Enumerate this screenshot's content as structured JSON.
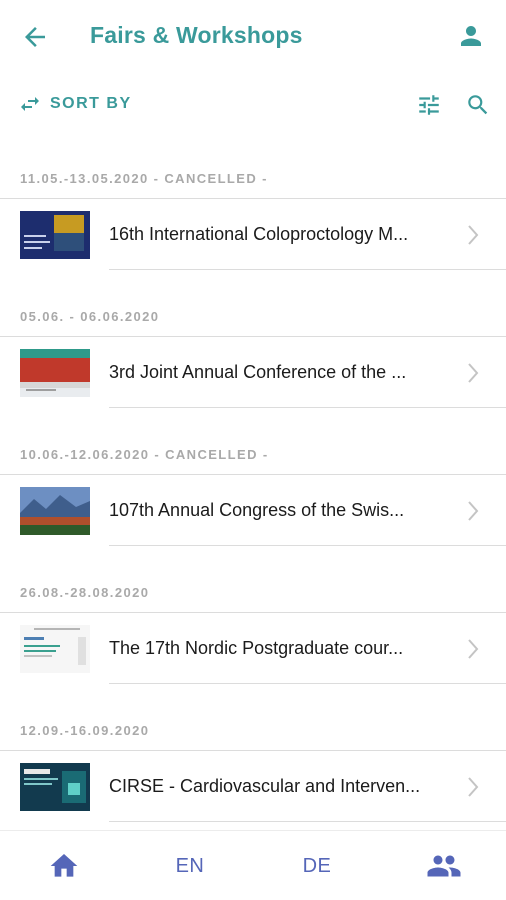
{
  "header": {
    "title": "Fairs & Workshops",
    "back_icon": "arrow-left-icon",
    "profile_icon": "person-icon"
  },
  "toolbar": {
    "sort_label": "SORT BY",
    "sort_icon": "swap-arrows-icon",
    "filter_icon": "tune-sliders-icon",
    "search_icon": "search-icon"
  },
  "colors": {
    "accent": "#3a9a9a",
    "nav": "#5566b8",
    "section_text": "#a9a9a9",
    "divider": "#dcdcdc"
  },
  "events": [
    {
      "date": "11.05.-13.05.2020 - CANCELLED -",
      "title": "16th International Coloproctology M..."
    },
    {
      "date": "05.06. - 06.06.2020",
      "title": "3rd Joint Annual Conference of the ..."
    },
    {
      "date": "10.06.-12.06.2020 - CANCELLED -",
      "title": "107th Annual Congress of the Swis..."
    },
    {
      "date": "26.08.-28.08.2020",
      "title": "The 17th Nordic Postgraduate cour..."
    },
    {
      "date": "12.09.-16.09.2020",
      "title": "CIRSE - Cardiovascular and Interven..."
    }
  ],
  "bottom_nav": {
    "home_icon": "home-icon",
    "lang_en": "EN",
    "lang_de": "DE",
    "people_icon": "people-icon"
  }
}
